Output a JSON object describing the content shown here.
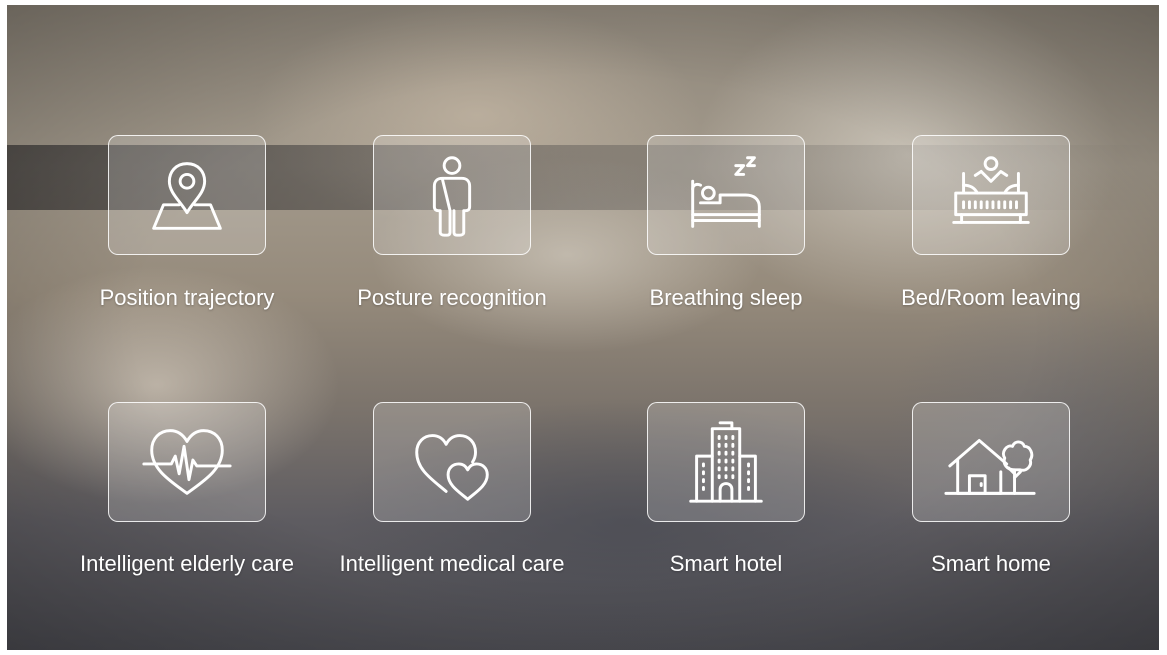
{
  "features": [
    {
      "label": "Position trajectory",
      "icon": "location-pin-icon"
    },
    {
      "label": "Posture recognition",
      "icon": "person-icon"
    },
    {
      "label": "Breathing sleep",
      "icon": "sleeping-bed-icon"
    },
    {
      "label": "Bed/Room leaving",
      "icon": "person-leaving-bed-icon"
    },
    {
      "label": "Intelligent elderly care",
      "icon": "heart-pulse-icon"
    },
    {
      "label": "Intelligent medical care",
      "icon": "double-heart-icon"
    },
    {
      "label": "Smart hotel",
      "icon": "hotel-building-icon"
    },
    {
      "label": "Smart home",
      "icon": "house-tree-icon"
    }
  ],
  "colors": {
    "icon_stroke": "#ffffff",
    "tile_border": "#ffffff",
    "label_text": "#ffffff"
  }
}
